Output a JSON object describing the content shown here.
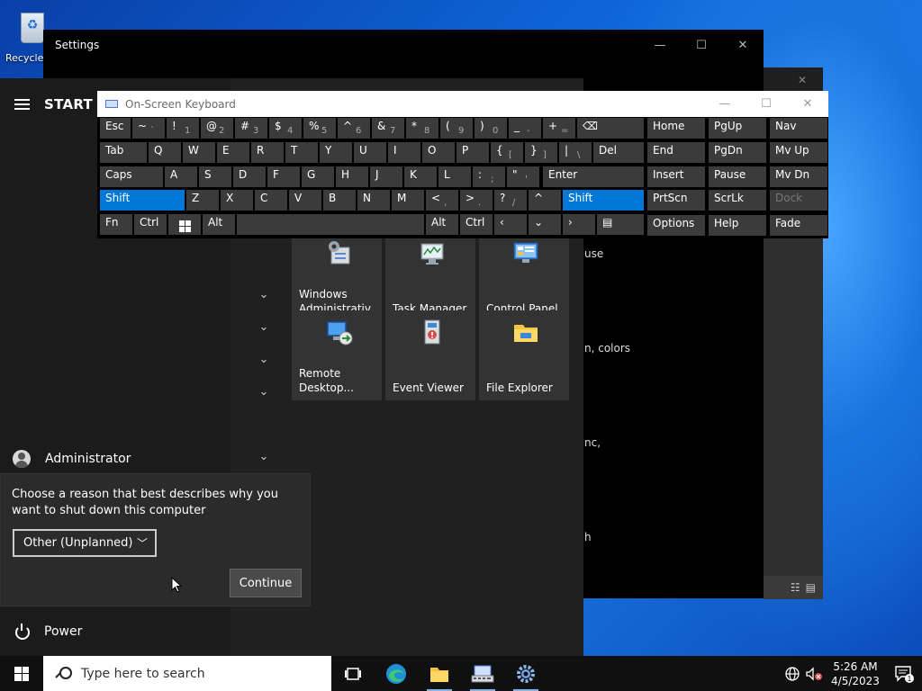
{
  "desktop": {
    "recycle_bin_label": "Recycle"
  },
  "settings_window": {
    "title": "Settings",
    "fragments": [
      "use",
      "n, colors",
      "nc,",
      "h"
    ]
  },
  "start_menu": {
    "title": "START",
    "user": "Administrator",
    "power": "Power",
    "tiles": [
      {
        "label": "Windows Administrativ...",
        "icon": "admin-tools-icon"
      },
      {
        "label": "Task Manager",
        "icon": "task-manager-icon"
      },
      {
        "label": "Control Panel",
        "icon": "control-panel-icon"
      },
      {
        "label": "Remote Desktop...",
        "icon": "remote-desktop-icon"
      },
      {
        "label": "Event Viewer",
        "icon": "event-viewer-icon"
      },
      {
        "label": "File Explorer",
        "icon": "file-explorer-icon"
      }
    ]
  },
  "shutdown_dialog": {
    "prompt": "Choose a reason that best describes why you want to shut down this computer",
    "selected_reason": "Other (Unplanned)",
    "continue_label": "Continue"
  },
  "osk": {
    "title": "On-Screen Keyboard",
    "row1": [
      "Esc",
      "~",
      "`",
      "!",
      "1",
      "@",
      "2",
      "#",
      "3",
      "$",
      "4",
      "%",
      "5",
      "^",
      "6",
      "&",
      "7",
      "*",
      "8",
      "(",
      "9",
      ")",
      "0",
      "_",
      "-",
      "+",
      "=",
      "⌫"
    ],
    "row2": [
      "Tab",
      "Q",
      "W",
      "E",
      "R",
      "T",
      "Y",
      "U",
      "I",
      "O",
      "P",
      "{",
      "[",
      "}",
      "]",
      "|",
      "\\",
      "Del"
    ],
    "row3": [
      "Caps",
      "A",
      "S",
      "D",
      "F",
      "G",
      "H",
      "J",
      "K",
      "L",
      ":",
      ";",
      "\"",
      "'",
      "Enter"
    ],
    "row4": [
      "Shift",
      "Z",
      "X",
      "C",
      "V",
      "B",
      "N",
      "M",
      "<",
      ",",
      ">",
      ".",
      "?",
      "/",
      "^",
      "Shift"
    ],
    "row5": [
      "Fn",
      "Ctrl",
      "Alt",
      "Alt",
      "Ctrl"
    ],
    "nav": [
      "Home",
      "PgUp",
      "Nav",
      "End",
      "PgDn",
      "Mv Up",
      "Insert",
      "Pause",
      "Mv Dn",
      "PrtScn",
      "ScrLk",
      "Dock",
      "Options",
      "Help",
      "Fade"
    ]
  },
  "taskbar": {
    "search_placeholder": "Type here to search",
    "time": "5:26 AM",
    "date": "4/5/2023",
    "notification_count": "1"
  },
  "colors": {
    "accent": "#0078d7",
    "start_bg": "#202020",
    "tile_bg": "#333333"
  }
}
